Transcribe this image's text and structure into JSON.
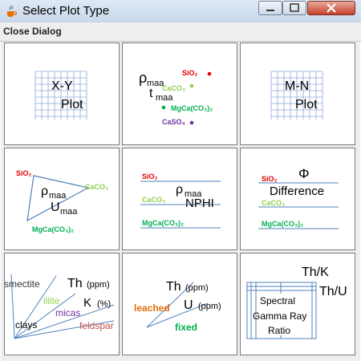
{
  "window": {
    "title": "Select Plot Type"
  },
  "menu": {
    "close_label": "Close Dialog"
  },
  "colors": {
    "red": "#e00000",
    "green": "#00b050",
    "light_green": "#92d050",
    "purple": "#7030a0",
    "orange": "#e46c0a",
    "dark_red": "#c0504d",
    "blue_line": "#4f81bd",
    "grid_line": "#8ea9db"
  },
  "cells": {
    "xy": {
      "line1": "X-Y",
      "line2": "Plot"
    },
    "rho_t": {
      "rho": "ρ",
      "rho_sub": "maa",
      "t": "t",
      "t_sub": "maa",
      "sio2": "SiO₂",
      "caco3": "CaCO₃",
      "mgca": "MgCa(CO₃)₂",
      "caso4": "CaSO₄"
    },
    "mn": {
      "line1": "M-N",
      "line2": "Plot"
    },
    "rho_u": {
      "sio2": "SiO₂",
      "caco3": "CaCO₃",
      "rho": "ρ",
      "rho_sub": "maa",
      "u": "U",
      "u_sub": "maa",
      "mgca": "MgCa(CO₃)₂"
    },
    "rho_nphi": {
      "sio2": "SiO₂",
      "rho": "ρ",
      "rho_sub": "maa",
      "caco3": "CaCO₃",
      "nphi": "NPHI",
      "mgca": "MgCa(CO₃)₂"
    },
    "phi_diff": {
      "phi": "Φ",
      "sio2": "SiO₂",
      "difference": "Difference",
      "caco3": "CaCO₃",
      "mgca": "MgCa(CO₃)₂"
    },
    "th_k": {
      "smectite": "smectite",
      "th": "Th",
      "th_unit": "(ppm)",
      "illite": "illite",
      "k": "K",
      "k_unit": "(%)",
      "micas": "micas",
      "clays": "clays",
      "feldspar": "feldspar"
    },
    "th_u": {
      "th": "Th",
      "th_unit": "(ppm)",
      "leached": "leached",
      "u": "U",
      "u_unit": "(ppm)",
      "fixed": "fixed"
    },
    "spectral": {
      "thk": "Th/K",
      "thu": "Th/U",
      "line1": "Spectral",
      "line2": "Gamma Ray",
      "line3": "Ratio"
    }
  }
}
